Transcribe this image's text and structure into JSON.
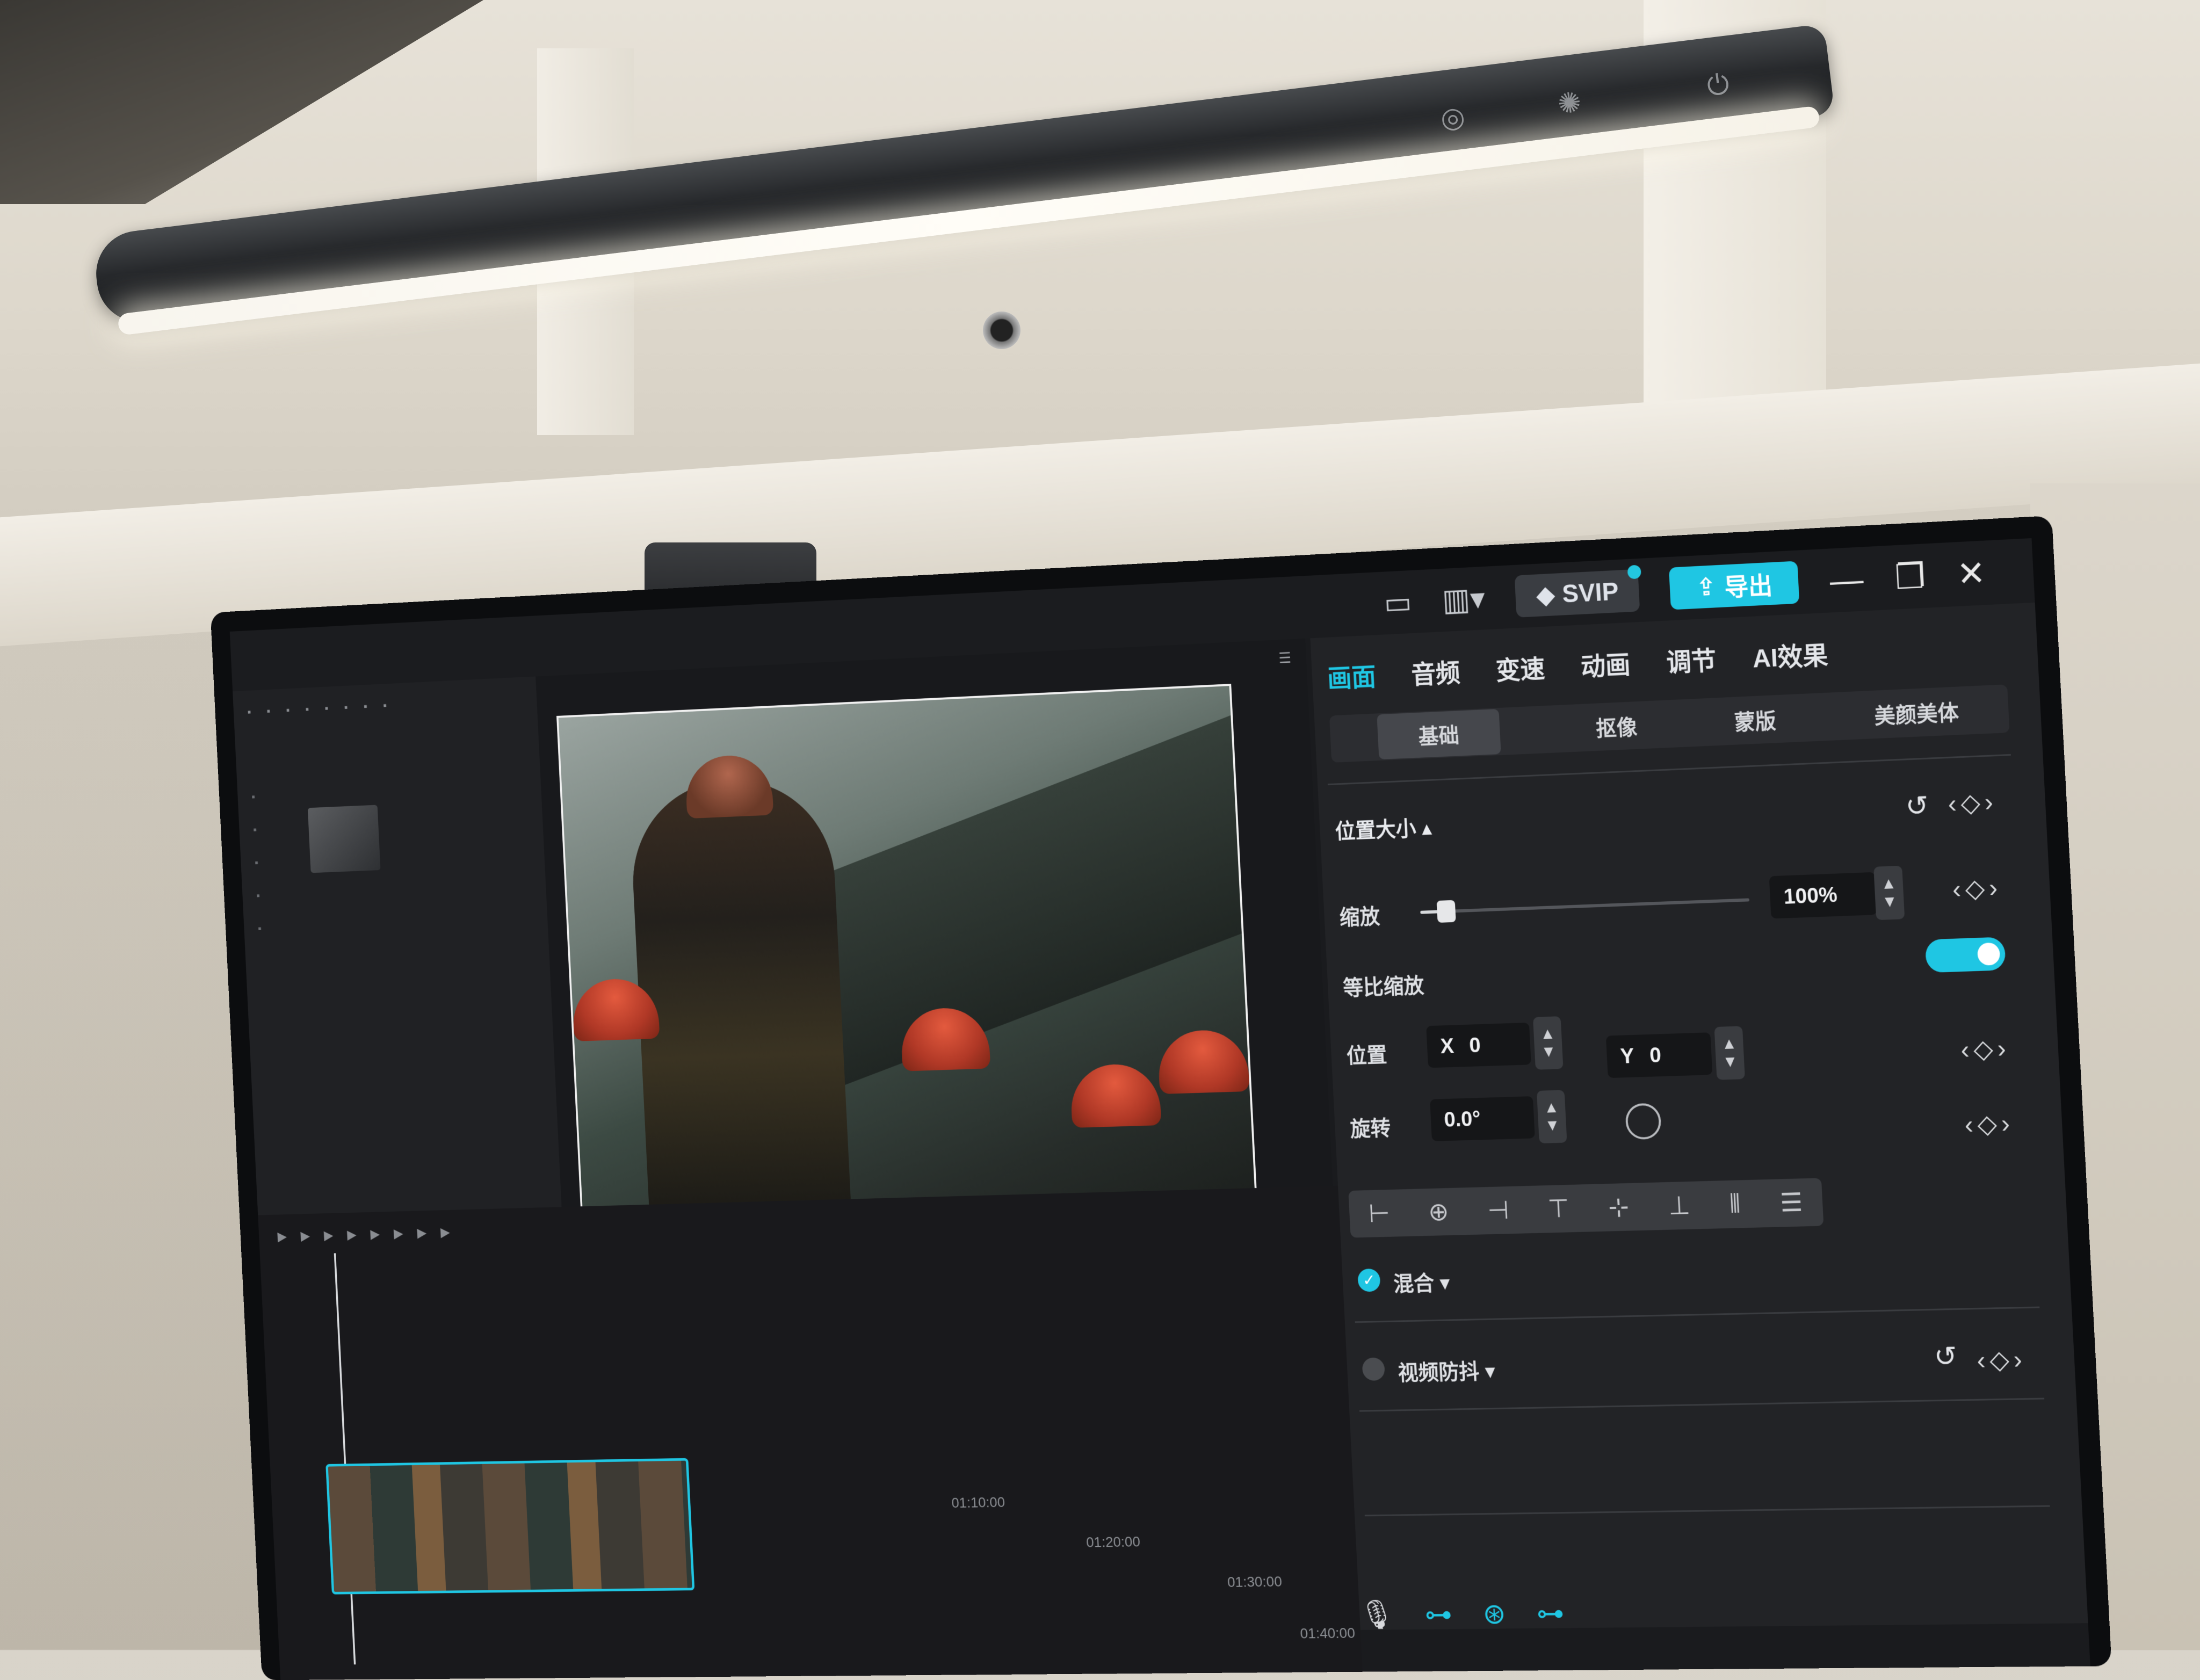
{
  "lamp": {
    "buttons": [
      "◎",
      "✺",
      "⏻"
    ]
  },
  "window": {
    "title": "",
    "toolbar_icons": [
      "▭",
      "▥▾"
    ],
    "svip_label": "SVIP",
    "export_label": "导出",
    "win_controls": [
      "—",
      "❐",
      "✕"
    ]
  },
  "player": {
    "menu_icon": "☰",
    "timecode": "",
    "footer_icons": [
      "▣",
      "⌖",
      "⊡",
      "⤢"
    ],
    "play_icon": "▶"
  },
  "props": {
    "tabs": [
      {
        "label": "画面",
        "active": true
      },
      {
        "label": "音频"
      },
      {
        "label": "变速"
      },
      {
        "label": "动画"
      },
      {
        "label": "调节"
      },
      {
        "label": "AI效果"
      }
    ],
    "sub_tabs": [
      {
        "label": "基础",
        "active": true
      },
      {
        "label": "抠像"
      },
      {
        "label": "蒙版"
      },
      {
        "label": "美颜美体"
      }
    ],
    "section_position_size": "位置大小 ▴",
    "scale_label": "缩放",
    "scale_value": "100%",
    "scale_fraction": 0.08,
    "uniform_scale_label": "等比缩放",
    "uniform_scale_on": true,
    "position_label": "位置",
    "x_label": "X",
    "x_value": "0",
    "y_label": "Y",
    "y_value": "0",
    "rotate_label": "旋转",
    "rotate_value": "0.0°",
    "keyframe_glyph": "‹◇›",
    "reset_glyph": "↺",
    "align_icons": [
      "⊢",
      "⊕",
      "⊣",
      "⊤",
      "⊹",
      "⊥",
      "⦀",
      "☰"
    ],
    "blend_label": "混合 ▾",
    "blend_checked": true,
    "stabilize_label": "视频防抖 ▾",
    "stabilize_checked": false
  },
  "timeline": {
    "times": [
      "01:10:00",
      "01:20:00",
      "01:30:00",
      "01:40:00"
    ],
    "bottom_icons": [
      "🎙",
      "⊶",
      "⊛",
      "⊶"
    ]
  }
}
